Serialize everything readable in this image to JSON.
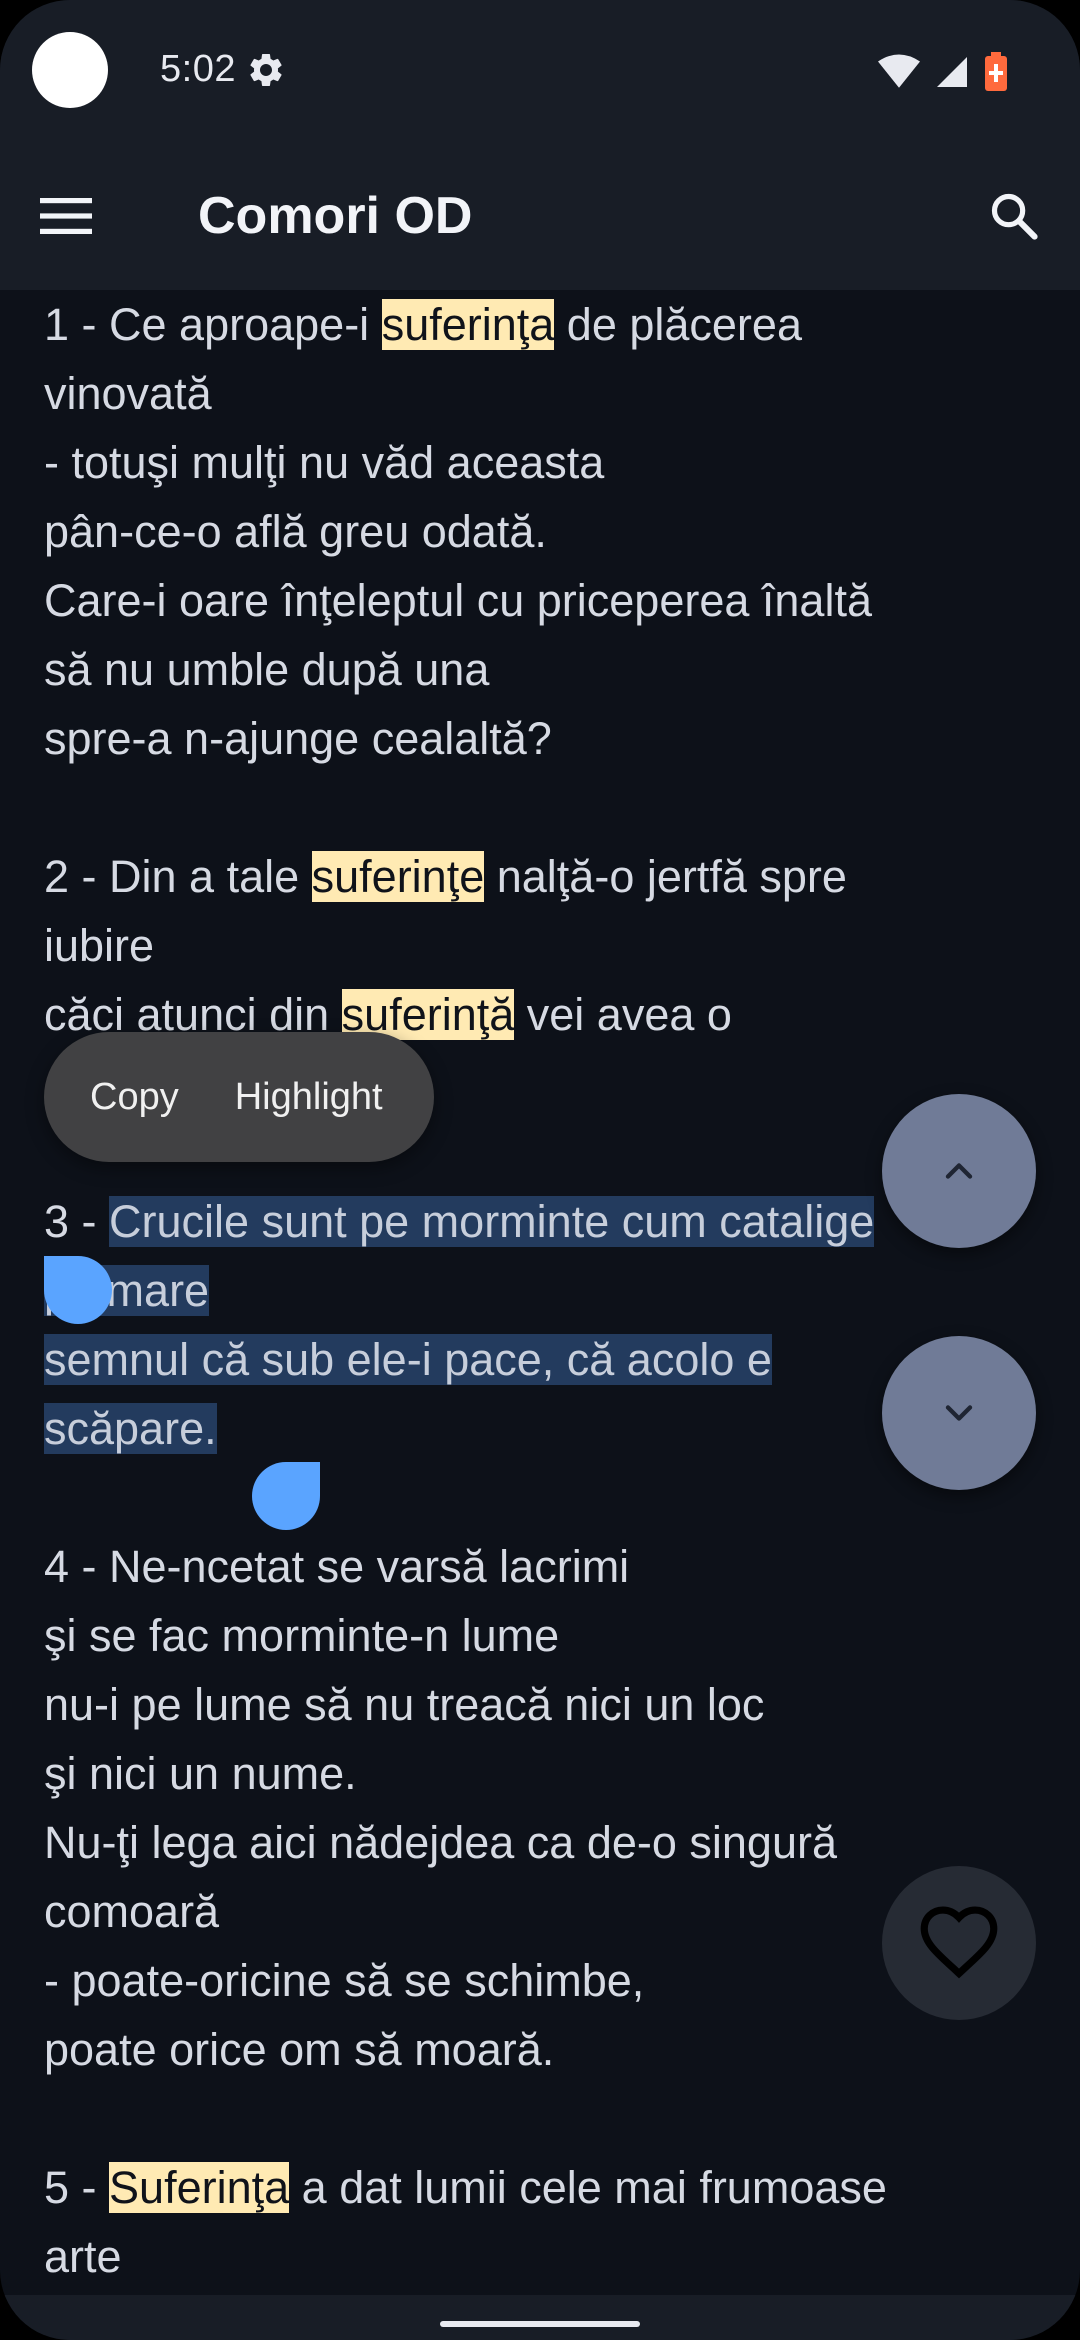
{
  "status_bar": {
    "time": "5:02",
    "icons": [
      "settings-gear-icon",
      "wifi-icon",
      "signal-icon",
      "battery-charging-icon"
    ],
    "battery_color": "#ff6a3d"
  },
  "app_bar": {
    "title": "Comori OD",
    "menu_icon": "hamburger-menu-icon",
    "search_icon": "search-icon"
  },
  "context_menu": {
    "copy": "Copy",
    "highlight": "Highlight"
  },
  "colors": {
    "background": "#0d1119",
    "bar": "#181d26",
    "highlight": "#ffeab3",
    "selection": "#233b5e",
    "handle": "#5aa4ff",
    "fab": "#707b97"
  },
  "content": {
    "p1": {
      "l1a": "1 - Ce aproape-i ",
      "l1h": "suferinţa",
      "l1b": " de plăcerea",
      "l2": "vinovată",
      "l3": "- totuşi mulţi nu văd aceasta",
      "l4": "pân-ce-o află greu odată.",
      "l5": "Care-i oare înţeleptul cu priceperea înaltă",
      "l6": "să nu umble după una",
      "l7": "spre-a n-ajunge cealaltă?"
    },
    "p2": {
      "l1a": "2 - Din a tale ",
      "l1h": "suferinţe",
      "l1b": " nalţă-o jertfă spre",
      "l2": "iubire",
      "l3a": "căci atunci din ",
      "l3h": "suferinţă",
      "l3b": " vei avea o"
    },
    "p3": {
      "l1a": "3 - ",
      "l1s": "Crucile sunt pe morminte cum catalige",
      "l2s": "pe mare",
      "l3s": "semnul că sub ele-i pace, că acolo e",
      "l4s": "scăpare."
    },
    "p4": {
      "l1": "4 - Ne-ncetat se varsă lacrimi",
      "l2": "şi se fac morminte-n lume",
      "l3": "nu-i pe lume să nu treacă nici un loc",
      "l4": "şi nici un nume.",
      "l5": "Nu-ţi lega aici nădejdea ca de-o singură",
      "l6": "comoară",
      "l7": "- poate-oricine să se schimbe,",
      "l8": "poate orice om să moară."
    },
    "p5": {
      "l1a": "5 - ",
      "l1h": "Suferinţa",
      "l1b": " a dat lumii cele mai frumoase",
      "l2": "arte"
    }
  },
  "fabs": {
    "up": "chevron-up-icon",
    "down": "chevron-down-icon",
    "favorite": "heart-outline-icon"
  }
}
